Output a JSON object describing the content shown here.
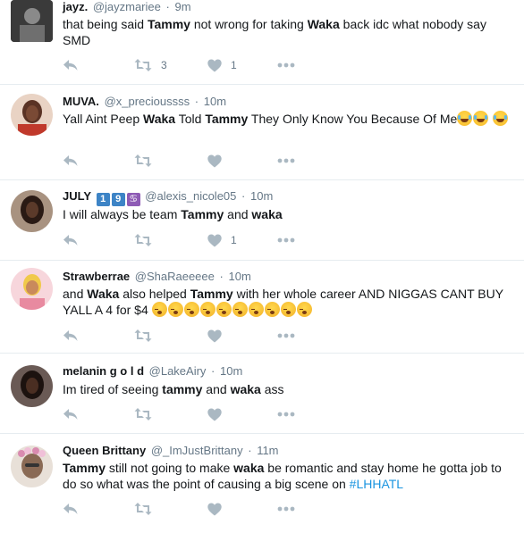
{
  "tweets": [
    {
      "name": "jayz.",
      "handle": "@jayzmariee",
      "time": "9m",
      "text_parts": [
        "that being said ",
        "Tammy",
        " not wrong for taking ",
        "Waka",
        " back idc what nobody say SMD"
      ],
      "retweets": "3",
      "likes": "1",
      "avatar_color": "#2b2b2b"
    },
    {
      "name": "MUVA.",
      "handle": "@x_precioussss",
      "time": "10m",
      "text_parts": [
        "Yall Aint Peep ",
        "Waka",
        " Told ",
        "Tammy",
        " They Only Know You Because Of Me"
      ],
      "retweets": "",
      "likes": "",
      "avatar_color": "#b5453a"
    },
    {
      "name": "JULY",
      "badges": [
        "1",
        "9",
        "♋"
      ],
      "handle": "@alexis_nicole05",
      "time": "10m",
      "text_parts": [
        "I will always be team ",
        "Tammy",
        " and ",
        "waka"
      ],
      "retweets": "",
      "likes": "1",
      "avatar_color": "#3b2a22"
    },
    {
      "name": "Strawberrae",
      "handle": "@ShaRaeeeee",
      "time": "10m",
      "text_parts": [
        "and ",
        "Waka",
        " also helped ",
        "Tammy",
        " with her whole career AND NIGGAS CANT BUY YALL A 4 for $4"
      ],
      "retweets": "",
      "likes": "",
      "avatar_color": "#f2c6c6"
    },
    {
      "name": "melanin g o l d",
      "handle": "@LakeAiry",
      "time": "10m",
      "text_parts": [
        "Im tired of seeing ",
        "tammy",
        " and ",
        "waka",
        " ass"
      ],
      "retweets": "",
      "likes": "",
      "avatar_color": "#2a1d1a"
    },
    {
      "name": "Queen Brittany",
      "handle": "@_ImJustBrittany",
      "time": "11m",
      "text_parts": [
        "Tammy",
        " still not going to make ",
        "waka",
        " be romantic and stay home he gotta job to do so what was the point of causing a big scene on "
      ],
      "hashtag": "#LHHATL",
      "retweets": "",
      "likes": "",
      "avatar_color": "#c9b7a6"
    }
  ],
  "dot_separator": "·",
  "colors": {
    "name": "#14171a",
    "meta": "#657786",
    "icon": "#aab8c2",
    "hashtag": "#1b95e0",
    "divider": "#e6ecf0"
  }
}
